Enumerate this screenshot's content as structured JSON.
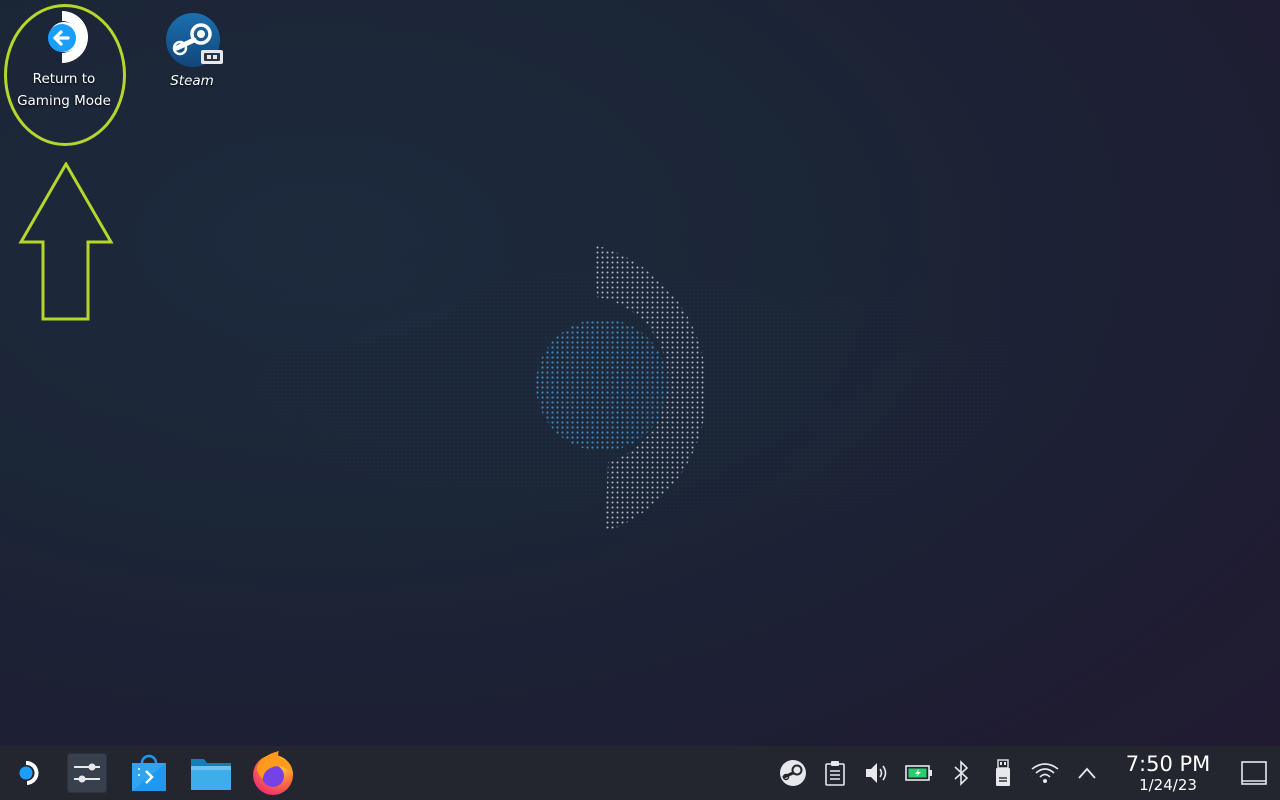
{
  "desktop": {
    "icons": [
      {
        "label_line1": "Return to",
        "label_line2": "Gaming Mode",
        "icon": "return-arrow-icon"
      },
      {
        "label": "Steam",
        "icon": "steam-icon"
      }
    ],
    "annotation": {
      "color": "#b5d62a"
    }
  },
  "taskbar": {
    "launchers": [
      {
        "icon": "steamos-menu-icon"
      },
      {
        "icon": "system-settings-icon"
      },
      {
        "icon": "discover-store-icon"
      },
      {
        "icon": "dolphin-files-icon"
      },
      {
        "icon": "firefox-icon"
      }
    ],
    "tray": [
      {
        "icon": "steam-tray-icon"
      },
      {
        "icon": "clipboard-icon"
      },
      {
        "icon": "volume-icon"
      },
      {
        "icon": "battery-icon"
      },
      {
        "icon": "bluetooth-icon"
      },
      {
        "icon": "usb-device-icon"
      },
      {
        "icon": "wifi-icon"
      },
      {
        "icon": "chevron-up-icon"
      }
    ],
    "clock": {
      "time": "7:50 PM",
      "date": "1/24/23"
    }
  },
  "colors": {
    "taskbar_bg": "#23262e",
    "accent_blue": "#1a9fff",
    "highlight": "#b5d62a"
  }
}
